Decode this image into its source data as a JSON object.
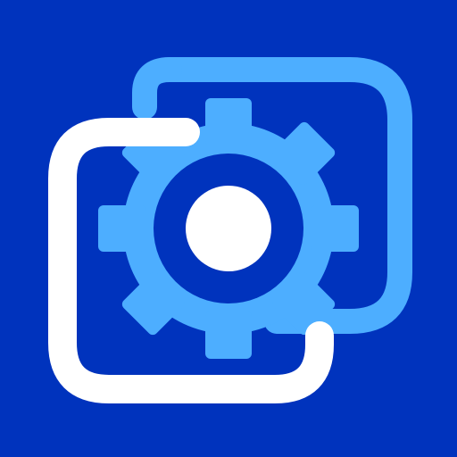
{
  "icon": {
    "name": "settings-windows-app-icon",
    "parts": [
      "back-window-icon",
      "front-window-icon",
      "gear-icon"
    ]
  },
  "colors": {
    "background": "#0033BD",
    "accent_light": "#4DAEFF",
    "white": "#FFFFFF"
  }
}
